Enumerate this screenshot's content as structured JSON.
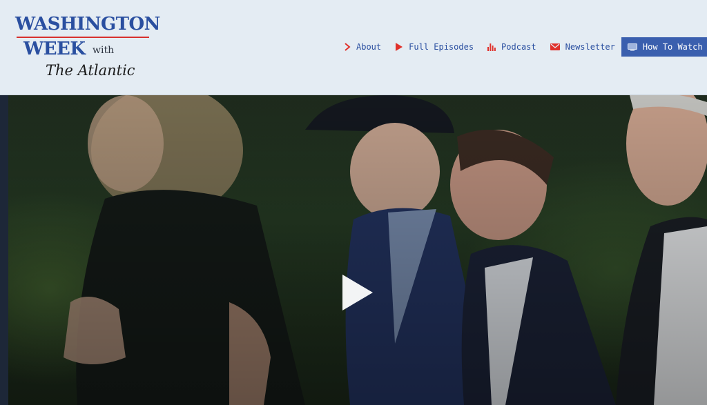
{
  "logo": {
    "line1": "WASHINGTON",
    "line2": "WEEK",
    "with": "with",
    "partner": "The Atlantic",
    "colors": {
      "blue": "#2a4fa0",
      "red": "#d8302d"
    }
  },
  "nav": {
    "items": [
      {
        "label": "About",
        "icon": "chevron-right-icon"
      },
      {
        "label": "Full Episodes",
        "icon": "play-icon"
      },
      {
        "label": "Podcast",
        "icon": "audio-bars-icon"
      },
      {
        "label": "Newsletter",
        "icon": "envelope-icon"
      }
    ],
    "cta": {
      "label": "How To Watch",
      "icon": "tv-icon"
    },
    "colors": {
      "text": "#2a4fa0",
      "icon": "#e0312b",
      "cta_bg": "#3a5fae"
    }
  },
  "video": {
    "play_icon": "play-icon"
  }
}
